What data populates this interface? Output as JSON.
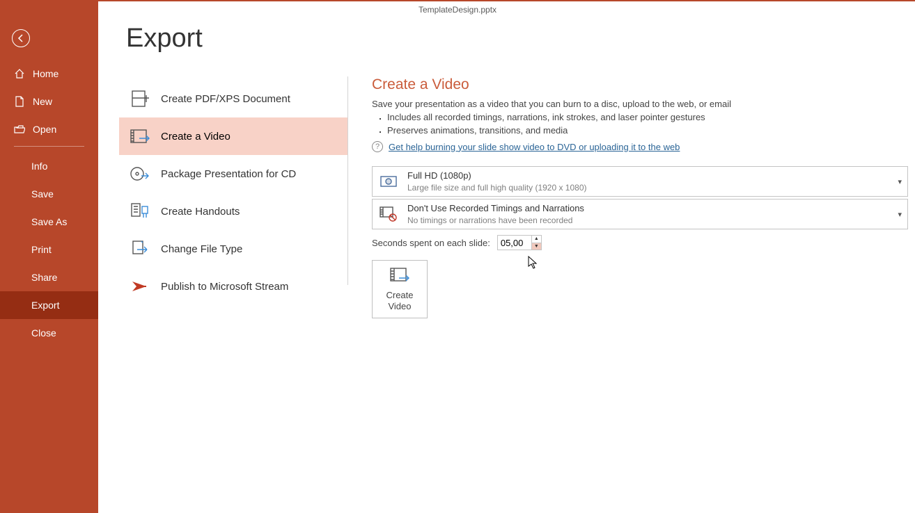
{
  "title": "TemplateDesign.pptx",
  "sidebar": {
    "items": [
      {
        "label": "Home"
      },
      {
        "label": "New"
      },
      {
        "label": "Open"
      },
      {
        "label": "Info"
      },
      {
        "label": "Save"
      },
      {
        "label": "Save As"
      },
      {
        "label": "Print"
      },
      {
        "label": "Share"
      },
      {
        "label": "Export"
      },
      {
        "label": "Close"
      }
    ]
  },
  "page": {
    "title": "Export"
  },
  "export_items": [
    {
      "label": "Create PDF/XPS Document"
    },
    {
      "label": "Create a Video"
    },
    {
      "label": "Package Presentation for CD"
    },
    {
      "label": "Create Handouts"
    },
    {
      "label": "Change File Type"
    },
    {
      "label": "Publish to Microsoft Stream"
    }
  ],
  "detail": {
    "title": "Create a Video",
    "desc": "Save your presentation as a video that you can burn to a disc, upload to the web, or email",
    "bullet1": "Includes all recorded timings, narrations, ink strokes, and laser pointer gestures",
    "bullet2": "Preserves animations, transitions, and media",
    "help": "Get help burning your slide show video to DVD or uploading it to the web",
    "quality": {
      "title": "Full HD (1080p)",
      "sub": "Large file size and full high quality (1920 x 1080)"
    },
    "timings": {
      "title": "Don't Use Recorded Timings and Narrations",
      "sub": "No timings or narrations have been recorded"
    },
    "seconds_label": "Seconds spent on each slide:",
    "seconds_value": "05,00",
    "create_btn": "Create\nVideo"
  }
}
